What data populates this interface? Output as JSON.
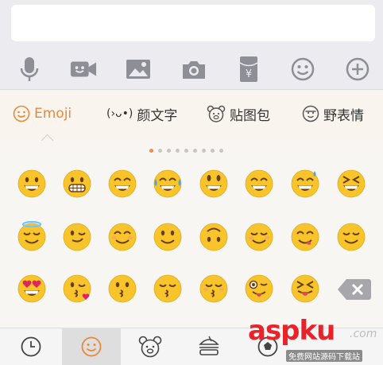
{
  "input": {
    "value": ""
  },
  "toolbar": {
    "icons": [
      "microphone-icon",
      "video-icon",
      "image-icon",
      "camera-icon",
      "red-packet-icon",
      "emoji-icon",
      "plus-icon"
    ],
    "red_packet_symbol": "¥",
    "color": "#8e8e96"
  },
  "tabs": [
    {
      "label": "Emoji",
      "active": true
    },
    {
      "label": "颜文字",
      "icon_text": "(›ᴗ•)",
      "active": false
    },
    {
      "label": "贴图包",
      "active": false
    },
    {
      "label": "野表情",
      "active": false
    }
  ],
  "pager": {
    "count": 9,
    "active": 0
  },
  "emoji_rows": [
    [
      "grinning",
      "grimacing",
      "beaming",
      "tears-of-joy",
      "smiley",
      "grin",
      "sweat-smile",
      "laughing"
    ],
    [
      "halo",
      "winking",
      "smiling",
      "slight-smile",
      "upside-down",
      "relaxed",
      "yum",
      "relieved"
    ],
    [
      "heart-eyes",
      "kissing-heart",
      "kissing",
      "kissing-smiling-eyes",
      "kissing-closed-eyes",
      "zany",
      "squinting-tongue"
    ]
  ],
  "bottom_bar": {
    "tabs": [
      "clock-icon",
      "emoji-icon",
      "bear-icon",
      "burger-icon",
      "ball-icon"
    ],
    "active": 1
  },
  "watermark": {
    "brand": "aspku",
    "suffix": ".com",
    "tagline": "免费网站源码下载站"
  },
  "colors": {
    "accent": "#e8893a",
    "dot_active": "#f08a4b",
    "emoji_yellow": "#f7c52b",
    "watermark_red": "#e8242a"
  }
}
